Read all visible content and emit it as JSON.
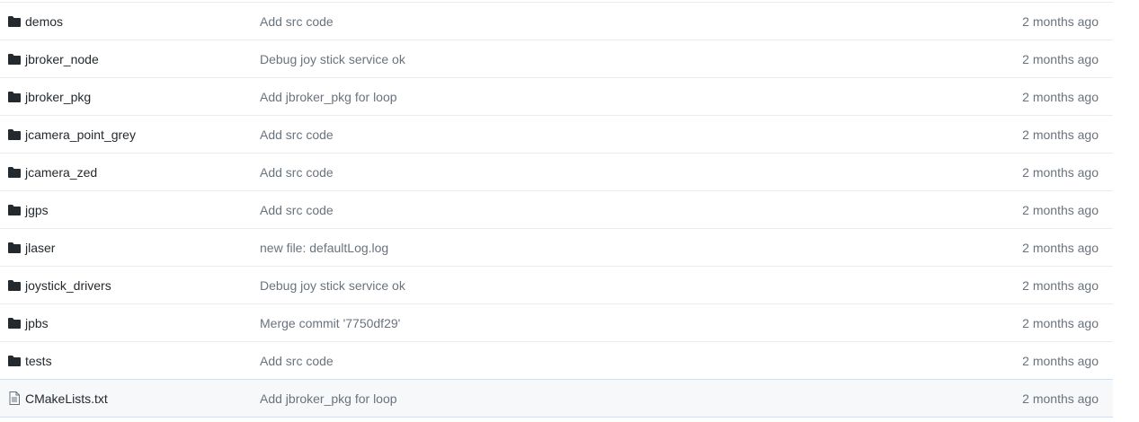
{
  "files": [
    {
      "name": "demos",
      "type": "folder",
      "icon": "folder-icon",
      "message": "Add src code",
      "age": "2 months ago"
    },
    {
      "name": "jbroker_node",
      "type": "folder",
      "icon": "folder-icon",
      "message": "Debug joy stick service ok",
      "age": "2 months ago"
    },
    {
      "name": "jbroker_pkg",
      "type": "folder",
      "icon": "folder-icon",
      "message": "Add jbroker_pkg for loop",
      "age": "2 months ago"
    },
    {
      "name": "jcamera_point_grey",
      "type": "folder",
      "icon": "folder-icon",
      "message": "Add src code",
      "age": "2 months ago"
    },
    {
      "name": "jcamera_zed",
      "type": "folder",
      "icon": "folder-icon",
      "message": "Add src code",
      "age": "2 months ago"
    },
    {
      "name": "jgps",
      "type": "folder",
      "icon": "folder-icon",
      "message": "Add src code",
      "age": "2 months ago"
    },
    {
      "name": "jlaser",
      "type": "folder",
      "icon": "folder-icon",
      "message": "new file: defaultLog.log",
      "age": "2 months ago"
    },
    {
      "name": "joystick_drivers",
      "type": "folder",
      "icon": "folder-icon",
      "message": "Debug joy stick service ok",
      "age": "2 months ago"
    },
    {
      "name": "jpbs",
      "type": "folder",
      "icon": "folder-icon",
      "message": "Merge commit '7750df29'",
      "age": "2 months ago"
    },
    {
      "name": "tests",
      "type": "folder",
      "icon": "folder-icon",
      "message": "Add src code",
      "age": "2 months ago"
    },
    {
      "name": "CMakeLists.txt",
      "type": "file",
      "icon": "file-text-icon",
      "message": "Add jbroker_pkg for loop",
      "age": "2 months ago",
      "highlighted": true
    }
  ],
  "colors": {
    "name_text": "#24292e",
    "muted_text": "#6a737d",
    "icon": "#24292e",
    "file_icon": "#6a737d",
    "row_border": "#eaecef",
    "highlight_bg": "#f6f8fa",
    "highlight_border": "#c8e1ff"
  }
}
